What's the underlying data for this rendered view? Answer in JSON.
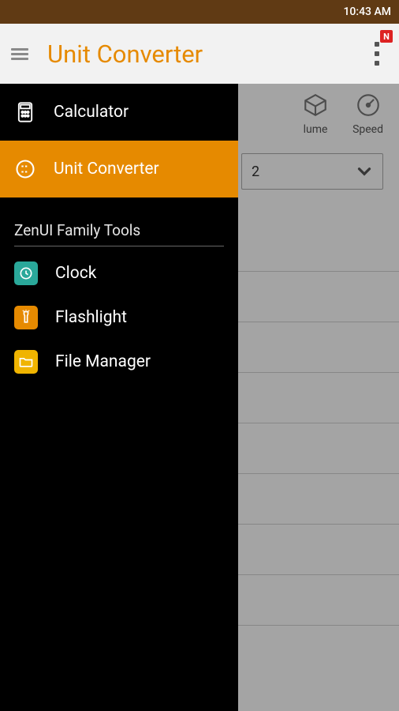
{
  "statusbar": {
    "time": "10:43 AM"
  },
  "appbar": {
    "title": "Unit Converter",
    "badge": "N"
  },
  "drawer": {
    "calculator": "Calculator",
    "unitconverter": "Unit Converter",
    "section": "ZenUI Family Tools",
    "clock": "Clock",
    "flashlight": "Flashlight",
    "filemanager": "File Manager"
  },
  "tabs": {
    "volume": "lume",
    "speed": "Speed"
  },
  "dropdown": {
    "value": "2"
  }
}
